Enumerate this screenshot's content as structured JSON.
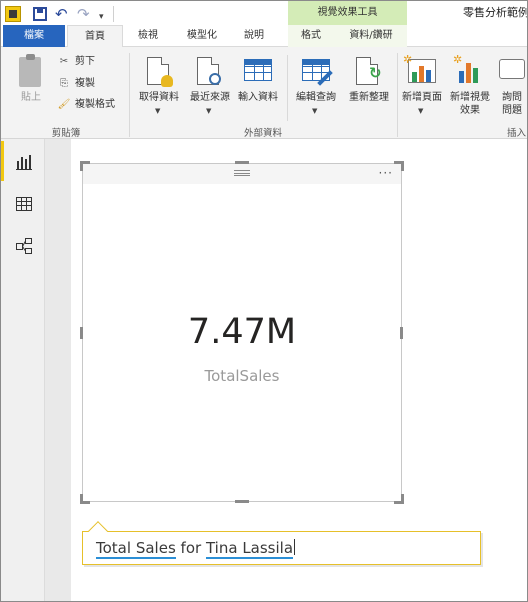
{
  "titlebar": {
    "contextual_tab_group": "視覺效果工具",
    "window_title": "零售分析範例"
  },
  "tabs": [
    {
      "label": "檔案"
    },
    {
      "label": "首頁"
    },
    {
      "label": "檢視"
    },
    {
      "label": "模型化"
    },
    {
      "label": "說明"
    },
    {
      "label": "格式"
    },
    {
      "label": "資料/鑽研"
    }
  ],
  "ribbon": {
    "clipboard": {
      "paste": "貼上",
      "cut": "剪下",
      "copy": "複製",
      "format_painter": "複製格式",
      "group_label": "剪貼簿"
    },
    "external_data": {
      "get_data": "取得資料",
      "recent_sources": "最近來源",
      "enter_data": "輸入資料",
      "edit_queries": "編輯查詢",
      "refresh": "重新整理",
      "group_label": "外部資料"
    },
    "insert": {
      "new_page": "新增頁面",
      "new_visual_line1": "新增視覺",
      "new_visual_line2": "效果",
      "ask_question_line1": "詢問",
      "ask_question_line2": "問題",
      "group_label": "插入"
    }
  },
  "leftnav": [
    {
      "icon": "report-view-icon"
    },
    {
      "icon": "data-view-icon"
    },
    {
      "icon": "relationships-view-icon"
    }
  ],
  "card": {
    "value": "7.47M",
    "label": "TotalSales",
    "more_options": "···"
  },
  "qna": {
    "word1": "Total",
    "word2": "Sales",
    "word3": "for",
    "word4": "Tina",
    "word5": "Lassila"
  }
}
